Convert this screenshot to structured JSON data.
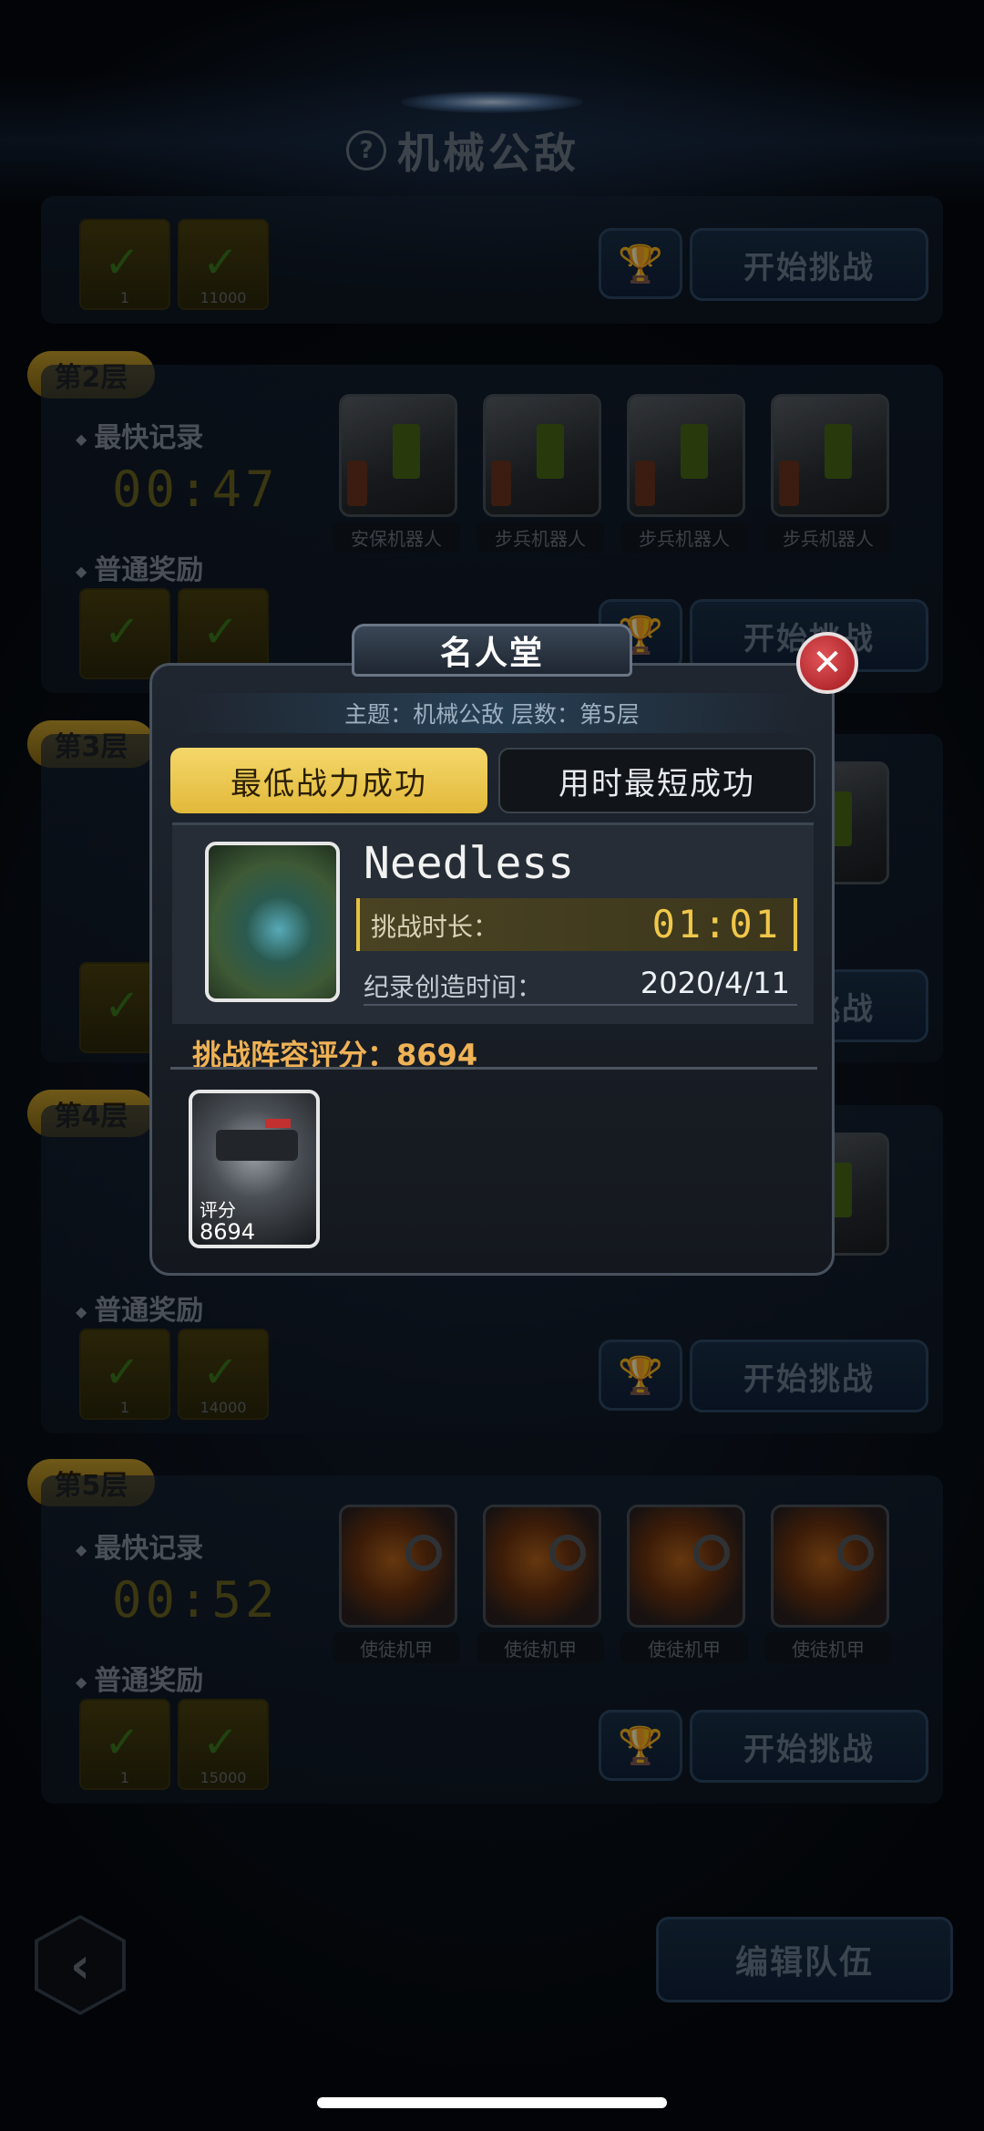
{
  "header": {
    "title": "机械公敌"
  },
  "labels": {
    "fastest": "最快记录",
    "reward": "普通奖励",
    "start": "开始挑战",
    "edit_team": "编辑队伍"
  },
  "floors": [
    {
      "rewards": [
        {
          "qty": "1"
        },
        {
          "qty": "11000"
        }
      ]
    },
    {
      "badge": "第2层",
      "time": "00:47",
      "enemies": [
        "安保机器人",
        "步兵机器人",
        "步兵机器人",
        "步兵机器人"
      ],
      "rewards": [
        {
          "qty": ""
        },
        {
          "qty": ""
        }
      ]
    },
    {
      "badge": "第3层"
    },
    {
      "badge": "第4层",
      "rewards": [
        {
          "qty": "1"
        },
        {
          "qty": "14000"
        }
      ]
    },
    {
      "badge": "第5层",
      "time": "00:52",
      "enemies": [
        "使徒机甲",
        "使徒机甲",
        "使徒机甲",
        "使徒机甲"
      ],
      "rewards": [
        {
          "qty": "1"
        },
        {
          "qty": "15000"
        }
      ]
    }
  ],
  "modal": {
    "title": "名人堂",
    "subject": "主题：机械公敌  层数：第5层",
    "tabs": {
      "active": "最低战力成功",
      "inactive": "用时最短成功"
    },
    "player": {
      "name": "Needless"
    },
    "duration": {
      "label": "挑战时长：",
      "value": "01:01"
    },
    "created": {
      "label": "纪录创造时间：",
      "value": "2020/4/11"
    },
    "lineup": {
      "score_label": "挑战阵容评分：",
      "score": "8694"
    },
    "hero": {
      "score_label": "评分",
      "score": "8694"
    }
  },
  "colors": {
    "accent_gold": "#f4d76a",
    "close_red": "#c0282c",
    "panel": "#1f2630"
  },
  "icons": {
    "help": "question-circle-icon",
    "trophy": "trophy-icon",
    "close": "close-x-icon",
    "back": "chevron-left-icon"
  }
}
